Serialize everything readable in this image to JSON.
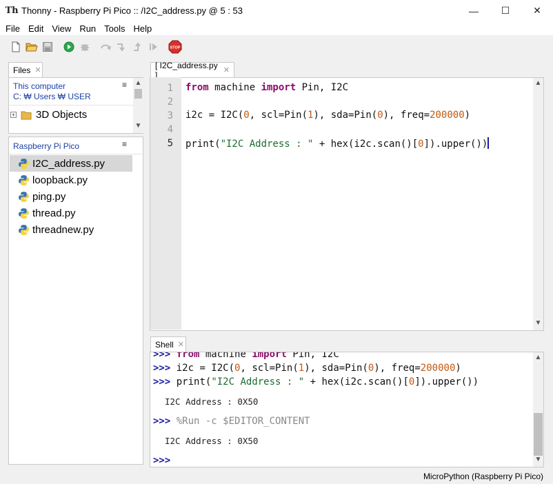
{
  "window": {
    "title": "Thonny  -  Raspberry Pi Pico :: /I2C_address.py  @  5 : 53",
    "app_icon": "Th",
    "minimize": "—",
    "maximize": "☐",
    "close": "✕"
  },
  "menu": [
    "File",
    "Edit",
    "View",
    "Run",
    "Tools",
    "Help"
  ],
  "toolbar": {
    "icons": [
      "new-file-icon",
      "open-folder-icon",
      "save-icon",
      "run-icon",
      "debug-icon",
      "step-over-icon",
      "step-into-icon",
      "step-out-icon",
      "resume-icon",
      "stop-icon"
    ],
    "stop_label": "STOP"
  },
  "files_panel": {
    "tab_label": "Files",
    "computer_header": "This computer",
    "computer_path": "C: ₩ Users ₩ USER",
    "computer_items": [
      {
        "name": "3D Objects"
      }
    ],
    "pico_header": "Raspberry Pi Pico",
    "pico_items": [
      {
        "name": "I2C_address.py",
        "selected": true
      },
      {
        "name": "loopback.py"
      },
      {
        "name": "ping.py"
      },
      {
        "name": "thread.py"
      },
      {
        "name": "threadnew.py"
      }
    ]
  },
  "editor": {
    "tab_label": "[ I2C_address.py ]",
    "line_numbers": [
      "1",
      "2",
      "3",
      "4",
      "5"
    ],
    "current_line": "5",
    "lines": [
      [
        {
          "t": "from",
          "c": "kw"
        },
        {
          "t": " machine ",
          "c": ""
        },
        {
          "t": "import",
          "c": "kw"
        },
        {
          "t": " Pin, I2C",
          "c": ""
        }
      ],
      [],
      [
        {
          "t": "i2c = I2C(",
          "c": ""
        },
        {
          "t": "0",
          "c": "num"
        },
        {
          "t": ", scl=Pin(",
          "c": ""
        },
        {
          "t": "1",
          "c": "num"
        },
        {
          "t": "), sda=Pin(",
          "c": ""
        },
        {
          "t": "0",
          "c": "num"
        },
        {
          "t": "), freq=",
          "c": ""
        },
        {
          "t": "200000",
          "c": "num"
        },
        {
          "t": ")",
          "c": ""
        }
      ],
      [],
      [
        {
          "t": "print(",
          "c": ""
        },
        {
          "t": "\"I2C Address : \"",
          "c": "str"
        },
        {
          "t": " + hex(i2c.scan()[",
          "c": ""
        },
        {
          "t": "0",
          "c": "num"
        },
        {
          "t": "]).upper())",
          "c": ""
        }
      ]
    ]
  },
  "shell": {
    "tab_label": "Shell",
    "prompt": ">>>",
    "cmd1": [
      {
        "t": "from",
        "c": "kw"
      },
      {
        "t": " machine ",
        "c": ""
      },
      {
        "t": "import",
        "c": "kw"
      },
      {
        "t": " Pin, I2C",
        "c": ""
      }
    ],
    "cmd2": [
      {
        "t": "i2c = I2C(",
        "c": ""
      },
      {
        "t": "0",
        "c": "num"
      },
      {
        "t": ", scl=Pin(",
        "c": ""
      },
      {
        "t": "1",
        "c": "num"
      },
      {
        "t": "), sda=Pin(",
        "c": ""
      },
      {
        "t": "0",
        "c": "num"
      },
      {
        "t": "), freq=",
        "c": ""
      },
      {
        "t": "200000",
        "c": "num"
      },
      {
        "t": ")",
        "c": ""
      }
    ],
    "cmd3": [
      {
        "t": "print(",
        "c": ""
      },
      {
        "t": "\"I2C Address : \"",
        "c": "str"
      },
      {
        "t": " + hex(i2c.scan()[",
        "c": ""
      },
      {
        "t": "0",
        "c": "num"
      },
      {
        "t": "]).upper())",
        "c": ""
      }
    ],
    "output1": "I2C Address : 0X50",
    "run_cmd": "%Run -c $EDITOR_CONTENT",
    "output2": "I2C Address : 0X50"
  },
  "status": {
    "interpreter": "MicroPython (Raspberry Pi Pico)"
  },
  "colors": {
    "keyword": "#8a0a6a",
    "number": "#c2570e",
    "string": "#1d6b2d",
    "prompt": "#1a1aa0"
  }
}
